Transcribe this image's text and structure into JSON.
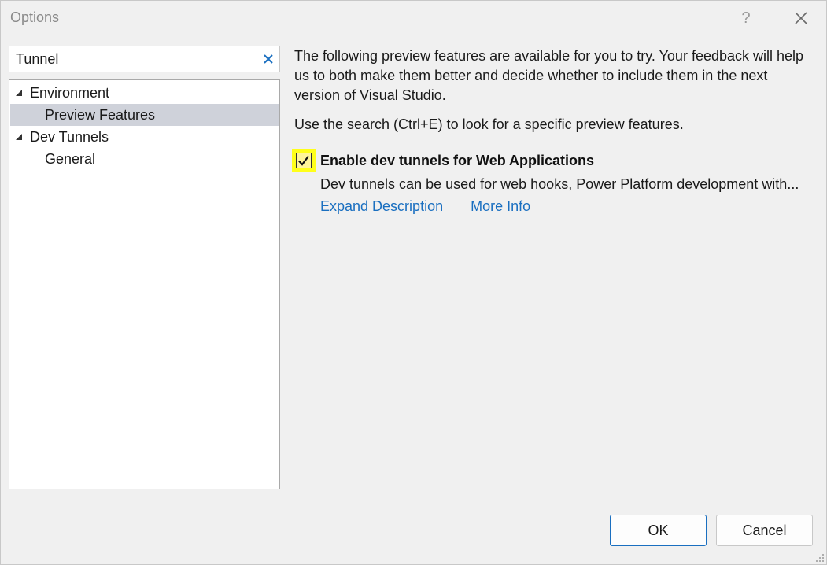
{
  "window": {
    "title": "Options",
    "help_label": "?"
  },
  "search": {
    "value": "Tunnel",
    "placeholder": ""
  },
  "tree": {
    "items": [
      {
        "label": "Environment",
        "expanded": true,
        "level": 0
      },
      {
        "label": "Preview Features",
        "level": 1,
        "selected": true
      },
      {
        "label": "Dev Tunnels",
        "expanded": true,
        "level": 0
      },
      {
        "label": "General",
        "level": 1
      }
    ]
  },
  "content": {
    "intro": "The following preview features are available for you to try. Your feedback will help us to both make them better and decide whether to include them in the next version of Visual Studio.",
    "search_hint": "Use the search (Ctrl+E) to look for a specific preview features.",
    "feature": {
      "title": "Enable dev tunnels for Web Applications",
      "description": "Dev tunnels can be used for web hooks, Power Platform development with...",
      "checked": true,
      "expand_link": "Expand Description",
      "more_info_link": "More Info"
    }
  },
  "buttons": {
    "ok": "OK",
    "cancel": "Cancel"
  },
  "colors": {
    "accent": "#1a6fc0",
    "selection": "#cfd2da",
    "highlight": "#ffff1a"
  }
}
